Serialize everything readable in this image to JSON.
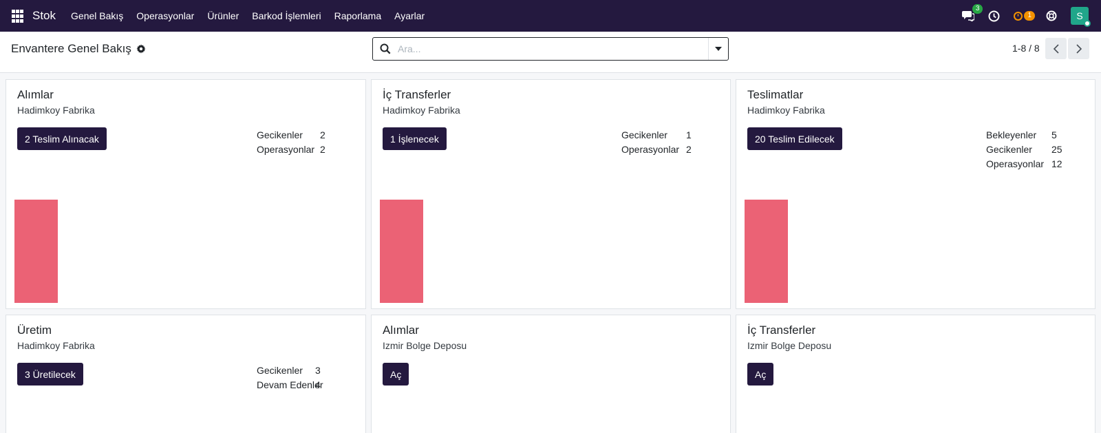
{
  "navbar": {
    "brand": "Stok",
    "menu": [
      "Genel Bakış",
      "Operasyonlar",
      "Ürünler",
      "Barkod İşlemleri",
      "Raporlama",
      "Ayarlar"
    ],
    "messages_badge": "3",
    "activity_badge": "1",
    "avatar_letter": "S",
    "bg_color": "#24193f"
  },
  "control_panel": {
    "title": "Envantere Genel Bakış",
    "search_placeholder": "Ara...",
    "pager": "1-8 / 8"
  },
  "cards": [
    {
      "title": "Alımlar",
      "warehouse": "Hadimkoy Fabrika",
      "button": "2 Teslim Alınacak",
      "stats": [
        {
          "label": "Gecikenler",
          "value": "2"
        },
        {
          "label": "Operasyonlar",
          "value": "2"
        }
      ],
      "graph_values": [
        2
      ]
    },
    {
      "title": "İç Transferler",
      "warehouse": "Hadimkoy Fabrika",
      "button": "1 İşlenecek",
      "stats": [
        {
          "label": "Gecikenler",
          "value": "1"
        },
        {
          "label": "Operasyonlar",
          "value": "2"
        }
      ],
      "graph_values": [
        1
      ]
    },
    {
      "title": "Teslimatlar",
      "warehouse": "Hadimkoy Fabrika",
      "button": "20 Teslim Edilecek",
      "stats": [
        {
          "label": "Bekleyenler",
          "value": "5"
        },
        {
          "label": "Gecikenler",
          "value": "25"
        },
        {
          "label": "Operasyonlar",
          "value": "12"
        }
      ],
      "graph_values": [
        25
      ]
    },
    {
      "title": "Üretim",
      "warehouse": "Hadimkoy Fabrika",
      "button": "3 Üretilecek",
      "stats": [
        {
          "label": "Gecikenler",
          "value": "3"
        },
        {
          "label": "Devam Edenler",
          "value": "4"
        }
      ]
    },
    {
      "title": "Alımlar",
      "warehouse": "Izmir Bolge Deposu",
      "button": "Aç",
      "stats": []
    },
    {
      "title": "İç Transferler",
      "warehouse": "Izmir Bolge Deposu",
      "button": "Aç",
      "stats": []
    }
  ],
  "colors": {
    "graph_bar": "#eb6275",
    "primary_button": "#24193f",
    "badge_green": "#28a745",
    "badge_orange": "#f39200",
    "avatar": "#20a68a"
  }
}
